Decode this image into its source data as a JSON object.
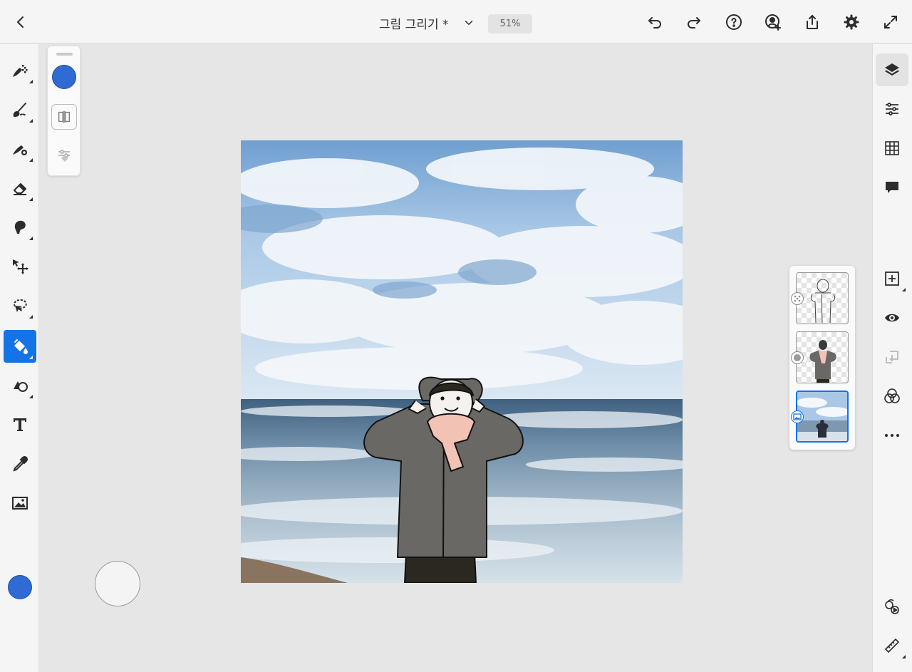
{
  "topbar": {
    "document_title": "그림 그리기 *",
    "zoom_level": "51%"
  },
  "left_toolbar": {
    "tools": [
      {
        "icon": "pixel-brush-icon",
        "active": false
      },
      {
        "icon": "live-brush-icon",
        "active": false
      },
      {
        "icon": "vector-brush-icon",
        "active": false
      },
      {
        "icon": "eraser-icon",
        "active": false
      },
      {
        "icon": "smudge-icon",
        "active": false
      },
      {
        "icon": "transform-icon",
        "active": false
      },
      {
        "icon": "lasso-selection-icon",
        "active": false
      },
      {
        "icon": "paint-bucket-icon",
        "active": true
      },
      {
        "icon": "shapes-icon",
        "active": false
      },
      {
        "icon": "text-icon",
        "active": false
      },
      {
        "icon": "eyedropper-icon",
        "active": false
      },
      {
        "icon": "place-image-icon",
        "active": false
      }
    ],
    "current_color": "#2f6ad5"
  },
  "tool_options": {
    "fill_color": "#2f6ad5",
    "sample_mode_icon": "sample-all-layers-icon",
    "gap_closure_icon": "gap-closure-icon"
  },
  "layers": [
    {
      "type": "line-art",
      "badge_icon": "vector-layer-icon",
      "selected": false
    },
    {
      "type": "color-fill",
      "badge_icon": "pixel-layer-icon",
      "selected": false
    },
    {
      "type": "photo",
      "badge_icon": "image-layer-icon",
      "selected": true
    }
  ],
  "right_toolbar": {
    "tools": [
      {
        "icon": "layers-icon",
        "active": true
      },
      {
        "icon": "layer-properties-icon",
        "active": false
      },
      {
        "icon": "grid-icon",
        "active": false
      },
      {
        "icon": "comments-icon",
        "active": false
      },
      {
        "icon": "add-layer-icon",
        "active": false
      },
      {
        "icon": "visibility-eye-icon",
        "active": false
      },
      {
        "icon": "merge-down-icon",
        "active": false
      },
      {
        "icon": "blend-mode-icon",
        "active": false
      },
      {
        "icon": "more-options-icon",
        "active": false
      },
      {
        "icon": "timelapse-replay-icon",
        "active": false
      },
      {
        "icon": "ruler-icon",
        "active": false
      }
    ]
  },
  "colors": {
    "accent": "#1473e6",
    "brush_blue": "#2f6ad5",
    "jacket": "#6a6864",
    "scarf": "#f2c2b5",
    "sky": "#a9c8e6",
    "sea": "#5e7e9c"
  }
}
